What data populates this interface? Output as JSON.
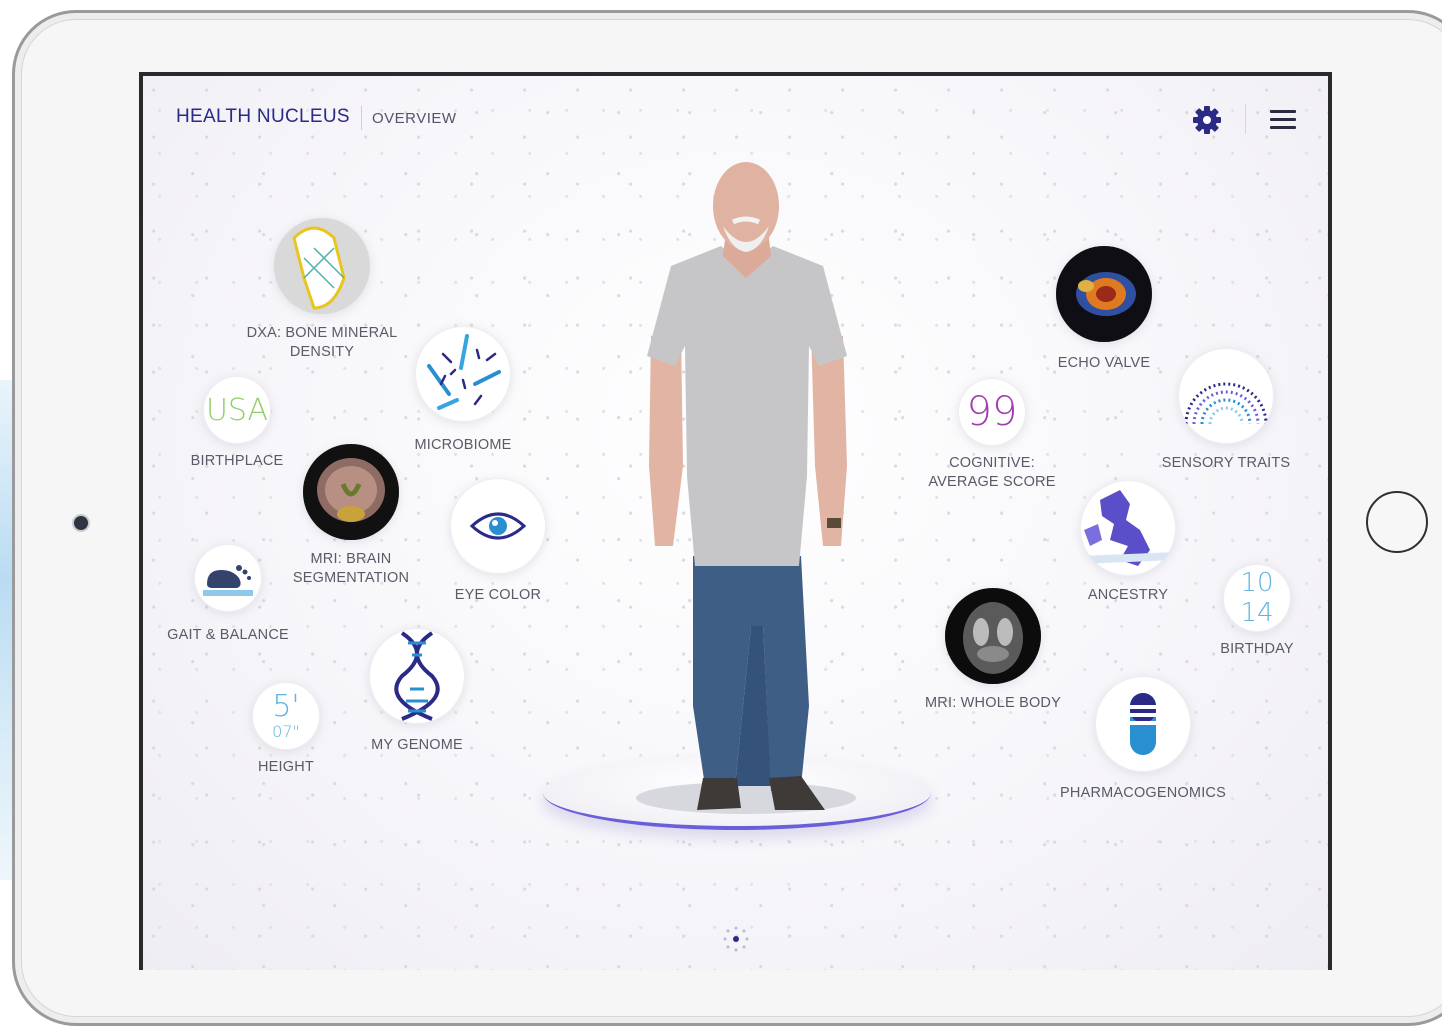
{
  "header": {
    "brand": "HEALTH NUCLEUS",
    "page": "OVERVIEW"
  },
  "icons": {
    "settings": "gear-icon",
    "menu": "hamburger-menu-icon"
  },
  "colors": {
    "brand": "#2b2a86",
    "accent_purple": "#6a5fd8",
    "birthplace_green": "#8fcf6a",
    "cognitive_purple": "#a23fb0",
    "height_blue": "#5fb3dd",
    "birthday_blue": "#5fb3dd"
  },
  "metrics": {
    "dxa": {
      "label": "DXA: BONE MINERAL DENSITY"
    },
    "microbiome": {
      "label": "MICROBIOME"
    },
    "birthplace": {
      "value": "USA",
      "label": "BIRTHPLACE"
    },
    "mri_brain": {
      "label": "MRI: BRAIN SEGMENTATION"
    },
    "eye_color": {
      "label": "EYE COLOR"
    },
    "gait": {
      "label": "GAIT & BALANCE"
    },
    "genome": {
      "label": "MY GENOME"
    },
    "height": {
      "feet": "5'",
      "inches": "07\"",
      "label": "HEIGHT"
    },
    "echo": {
      "label": "ECHO VALVE"
    },
    "sensory": {
      "label": "SENSORY TRAITS"
    },
    "cognitive": {
      "value": "99",
      "label": "COGNITIVE: AVERAGE SCORE"
    },
    "ancestry": {
      "label": "ANCESTRY"
    },
    "birthday": {
      "month": "10",
      "day": "14",
      "label": "BIRTHDAY"
    },
    "mri_body": {
      "label": "MRI: WHOLE BODY"
    },
    "pharma": {
      "label": "PHARMACOGENOMICS"
    }
  }
}
